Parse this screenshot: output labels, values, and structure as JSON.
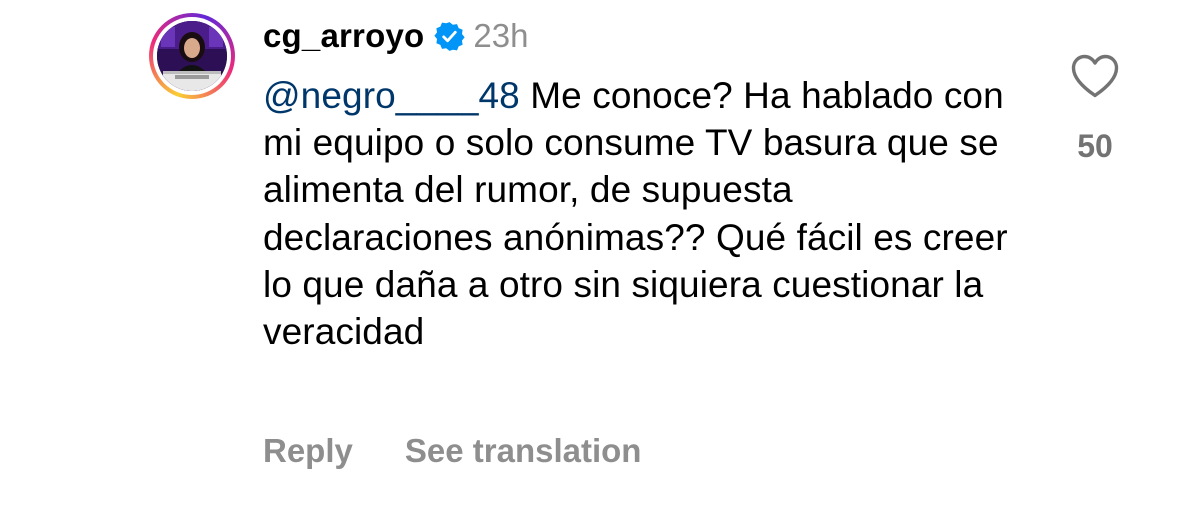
{
  "comment": {
    "username": "cg_arroyo",
    "verified": true,
    "timestamp": "23h",
    "mention": "@negro____48",
    "text": " Me conoce? Ha hablado con mi equipo o solo consume TV basura que se alimenta del rumor, de supuesta declaraciones anónimas?? Qué fácil es creer lo que daña a otro sin siquiera cuestionar la veracidad",
    "likes": "50"
  },
  "actions": {
    "reply_label": "Reply",
    "translate_label": "See translation"
  },
  "icons": {
    "like": "heart-outline-icon",
    "verified": "verified-badge-icon"
  },
  "colors": {
    "mention": "#00376b",
    "secondary_text": "#8e8e8e",
    "verified_badge": "#0095f6",
    "heart_outline": "#737373"
  }
}
